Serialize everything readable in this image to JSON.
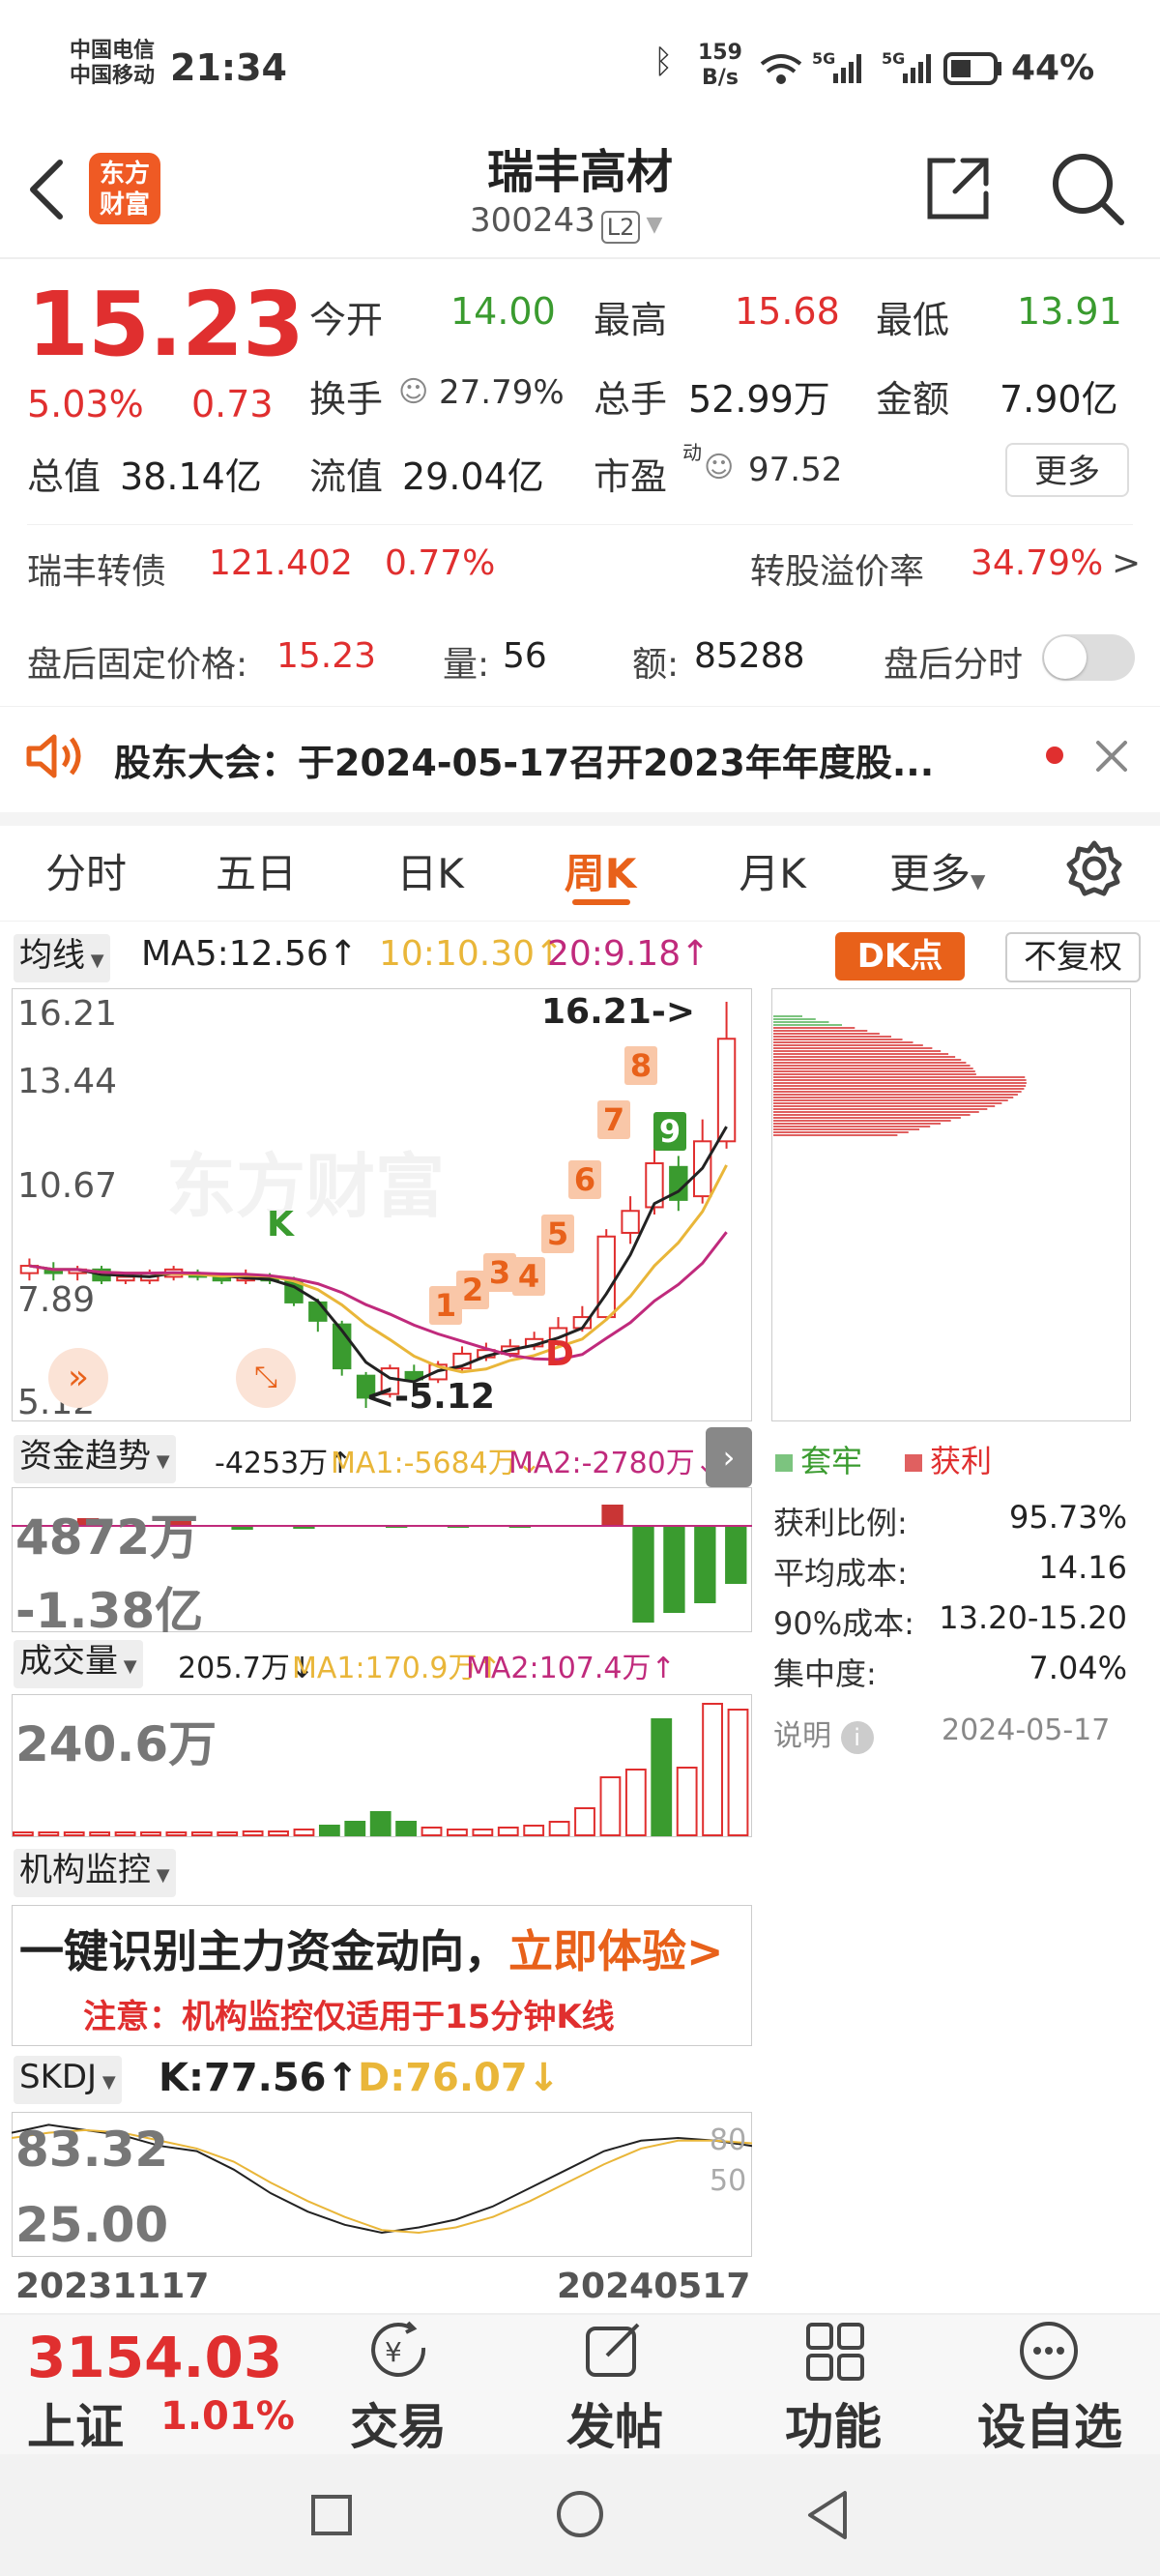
{
  "status_bar": {
    "carrier1": "中国电信",
    "carrier2": "中国移动",
    "time": "21:34",
    "net_speed": "159",
    "net_speed_unit": "B/s",
    "battery": "44%"
  },
  "header": {
    "logo_line1": "东方",
    "logo_line2": "财富",
    "stock_name": "瑞丰高材",
    "stock_code": "300243",
    "level": "L2"
  },
  "quote": {
    "price": "15.23",
    "change_pct": "5.03%",
    "change_amt": "0.73",
    "open_label": "今开",
    "open_val": "14.00",
    "high_label": "最高",
    "high_val": "15.68",
    "low_label": "最低",
    "low_val": "13.91",
    "turnover_label": "换手",
    "turnover_val": "27.79%",
    "volume_label": "总手",
    "volume_val": "52.99万",
    "amount_label": "金额",
    "amount_val": "7.90亿",
    "mktcap_label": "总值",
    "mktcap_val": "38.14亿",
    "float_label": "流值",
    "float_val": "29.04亿",
    "pe_label": "市盈",
    "pe_sup": "动",
    "pe_val": "97.52",
    "more": "更多"
  },
  "bond": {
    "name": "瑞丰转债",
    "price": "121.402",
    "pct": "0.77%",
    "premium_label": "转股溢价率",
    "premium_val": "34.79%",
    "arrow": ">"
  },
  "after_hours": {
    "fixed_label": "盘后固定价格:",
    "fixed_val": "15.23",
    "vol_label": "量:",
    "vol_val": "56",
    "amt_label": "额:",
    "amt_val": "85288",
    "toggle_label": "盘后分时"
  },
  "notice": {
    "text": "股东大会：于2024-05-17召开2023年年度股..."
  },
  "tabs": [
    {
      "label": "分时"
    },
    {
      "label": "五日"
    },
    {
      "label": "日K"
    },
    {
      "label": "周K"
    },
    {
      "label": "月K"
    },
    {
      "label": "更多"
    }
  ],
  "ma_bar": {
    "selector": "均线",
    "ma5": "MA5:12.56",
    "ma10": "10:10.30",
    "ma20": "20:9.18",
    "dk_btn": "DK点",
    "fq_btn": "不复权"
  },
  "kline": {
    "y_labels": [
      "16.21",
      "13.44",
      "10.67",
      "7.89",
      "5.12"
    ],
    "high_mark": "16.21->",
    "low_mark": "<-5.12",
    "k_mark": "K",
    "d_mark": "D",
    "seq": [
      "1",
      "2",
      "3",
      "4",
      "5",
      "6",
      "7",
      "8",
      "9"
    ],
    "watermark": "东方财富"
  },
  "chip": {
    "legend_trapped": "套牢",
    "legend_profit": "获利",
    "profit_ratio_label": "获利比例:",
    "profit_ratio_val": "95.73%",
    "avg_cost_label": "平均成本:",
    "avg_cost_val": "14.16",
    "cost90_label": "90%成本:",
    "cost90_val": "13.20-15.20",
    "concentration_label": "集中度:",
    "concentration_val": "7.04%",
    "explain": "说明",
    "date": "2024-05-17"
  },
  "fund": {
    "selector": "资金趋势",
    "value": "-4253万",
    "ma1": "MA1:-5684万",
    "ma2": "MA2:-2780万",
    "y_top": "4872万",
    "y_bottom": "-1.38亿"
  },
  "volume": {
    "selector": "成交量",
    "value": "205.7万",
    "ma1": "MA1:170.9万",
    "ma2": "MA2:107.4万",
    "y_top": "240.6万"
  },
  "inst": {
    "selector": "机构监控",
    "banner_main": "一键识别主力资金动向，",
    "banner_cta": "立即体验>",
    "banner_note": "注意：机构监控仅适用于15分钟K线"
  },
  "skdj": {
    "selector": "SKDJ",
    "k": "K:77.56",
    "d": "D:76.07",
    "y_top": "83.32",
    "y_bottom": "25.00",
    "ref80": "80",
    "ref50": "50",
    "date_start": "20231117",
    "date_end": "20240517"
  },
  "bottom": {
    "index_val": "3154.03",
    "index_name": "上证",
    "index_pct": "1.01%",
    "trade": "交易",
    "post": "发帖",
    "func": "功能",
    "watch": "设自选"
  },
  "colors": {
    "red": "#e02f2f",
    "green": "#3a9b2f",
    "orange": "#e8611a"
  }
}
